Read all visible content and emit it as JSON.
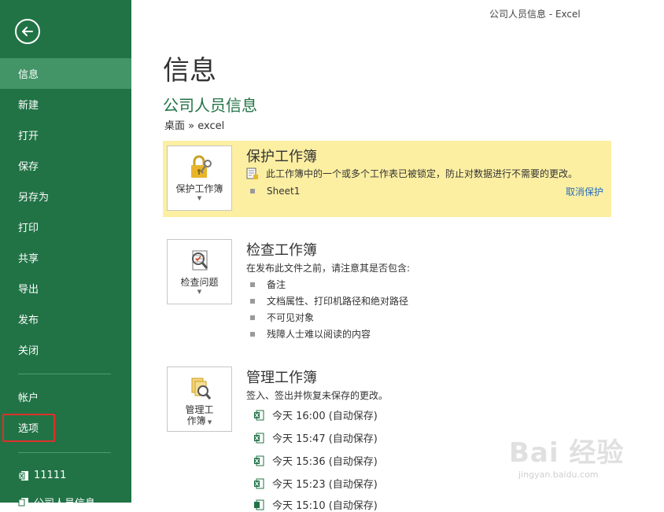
{
  "window": {
    "title": "公司人员信息 - Excel"
  },
  "sidebar": {
    "items": [
      {
        "label": "信息"
      },
      {
        "label": "新建"
      },
      {
        "label": "打开"
      },
      {
        "label": "保存"
      },
      {
        "label": "另存为"
      },
      {
        "label": "打印"
      },
      {
        "label": "共享"
      },
      {
        "label": "导出"
      },
      {
        "label": "发布"
      },
      {
        "label": "关闭"
      }
    ],
    "account_label": "帐户",
    "options_label": "选项",
    "recent": [
      {
        "label": "11111"
      },
      {
        "label": "公司人员信息"
      }
    ],
    "accent": "#217346",
    "active_bg": "#439467"
  },
  "main": {
    "page_title": "信息",
    "doc_title": "公司人员信息",
    "doc_path": "桌面 » excel",
    "protect": {
      "button_label": "保护工作簿",
      "heading": "保护工作簿",
      "desc": "此工作簿中的一个或多个工作表已被锁定，防止对数据进行不需要的更改。",
      "sheet": "Sheet1",
      "unprotect_link": "取消保护",
      "bg": "#fcefa2"
    },
    "inspect": {
      "button_label": "检查问题",
      "heading": "检查工作簿",
      "desc": "在发布此文件之前，请注意其是否包含:",
      "items": [
        {
          "label": "备注"
        },
        {
          "label": "文档属性、打印机路径和绝对路径"
        },
        {
          "label": "不可见对象"
        },
        {
          "label": "残障人士难以阅读的内容"
        }
      ]
    },
    "manage": {
      "button_label_1": "管理工",
      "button_label_2": "作簿",
      "heading": "管理工作簿",
      "desc": "签入、签出并恢复未保存的更改。",
      "versions": [
        {
          "label": "今天 16:00 (自动保存)"
        },
        {
          "label": "今天 15:47 (自动保存)"
        },
        {
          "label": "今天 15:36 (自动保存)"
        },
        {
          "label": "今天 15:23 (自动保存)"
        },
        {
          "label": "今天 15:10 (自动保存)"
        }
      ]
    }
  },
  "watermark": {
    "main": "Bai 经验",
    "sub": "jingyan.baidu.com"
  }
}
